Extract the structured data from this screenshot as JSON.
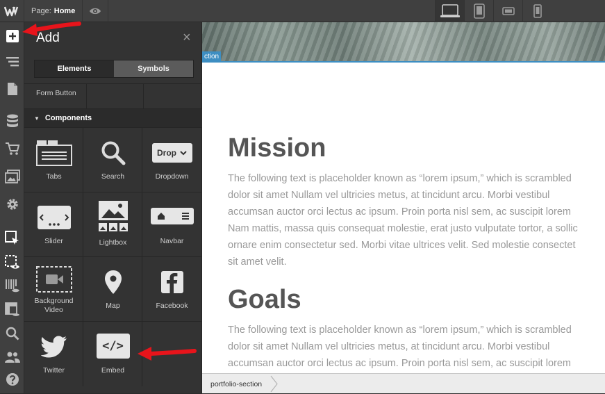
{
  "topbar": {
    "logo_text": "W",
    "page_prefix": "Page:",
    "page_name": "Home",
    "devices": [
      "desktop-icon",
      "tablet-icon",
      "mobile-landscape-icon",
      "mobile-portrait-icon"
    ]
  },
  "rail": {
    "items": [
      "add-icon",
      "navigator-icon",
      "pages-icon",
      "cms-icon",
      "ecommerce-icon",
      "assets-icon",
      "settings-icon",
      "select-icon",
      "preview-icon",
      "audit-icon",
      "style-manager-icon",
      "search-icon",
      "users-icon",
      "help-icon"
    ]
  },
  "panel": {
    "title": "Add",
    "close": "×",
    "tab_elements": "Elements",
    "tab_symbols": "Symbols",
    "form_button": "Form Button",
    "components_header": "Components",
    "tiles": [
      {
        "label": "Tabs"
      },
      {
        "label": "Search"
      },
      {
        "label": "Dropdown",
        "icon_text": "Drop"
      },
      {
        "label": "Slider"
      },
      {
        "label": "Lightbox"
      },
      {
        "label": "Navbar"
      },
      {
        "label": "Background Video"
      },
      {
        "label": "Map"
      },
      {
        "label": "Facebook"
      },
      {
        "label": "Twitter"
      },
      {
        "label": "Embed",
        "icon_text": "</>"
      }
    ]
  },
  "canvas": {
    "section_tag": "ction",
    "mission_title": "Mission",
    "mission_lines": [
      "The following text is placeholder known as “lorem ipsum,” which is scrambled",
      "dolor sit amet Nullam vel ultricies metus, at tincidunt arcu. Morbi vestibul",
      "accumsan auctor orci lectus ac ipsum. Proin porta nisl sem, ac suscipit lorem",
      "Nam mattis, massa quis consequat molestie, erat justo vulputate tortor, a sollic",
      "ornare enim consectetur sed. Morbi vitae ultrices velit. Sed molestie consectet",
      "sit amet velit."
    ],
    "goals_title": "Goals",
    "goals_lines": [
      "The following text is placeholder known as “lorem ipsum,” which is scrambled",
      "dolor sit amet Nullam vel ultricies metus, at tincidunt arcu. Morbi vestibul",
      "accumsan auctor orci lectus ac ipsum. Proin porta nisl sem, ac suscipit lorem"
    ]
  },
  "breadcrumb": {
    "item": "portfolio-section"
  },
  "colors": {
    "accent": "#3d8ec2",
    "arrow": "#e8141b"
  }
}
